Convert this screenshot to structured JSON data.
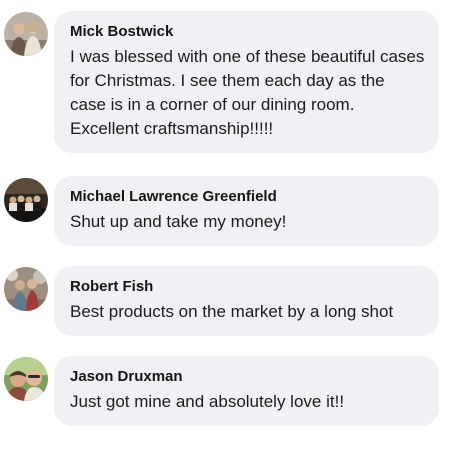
{
  "comments": [
    {
      "author": "Mick Bostwick",
      "avatar": "profile-photo-couple",
      "text": "I was blessed with one of these beautiful cases for Christmas. I see them each day as the case is in a corner of our dining room. Excellent craftsmanship!!!!!"
    },
    {
      "author": "Michael Lawrence Greenfield",
      "avatar": "profile-photo-group",
      "text": "Shut up and take my money!"
    },
    {
      "author": "Robert Fish",
      "avatar": "profile-photo-outdoor-couple",
      "text": "Best products on the market by a long shot"
    },
    {
      "author": "Jason Druxman",
      "avatar": "profile-photo-selfie",
      "text": "Just got mine and absolutely love it!!"
    }
  ],
  "colors": {
    "bubble_background": "#f0f1f4",
    "author_text": "#161616",
    "body_text": "#1c1c1c"
  }
}
